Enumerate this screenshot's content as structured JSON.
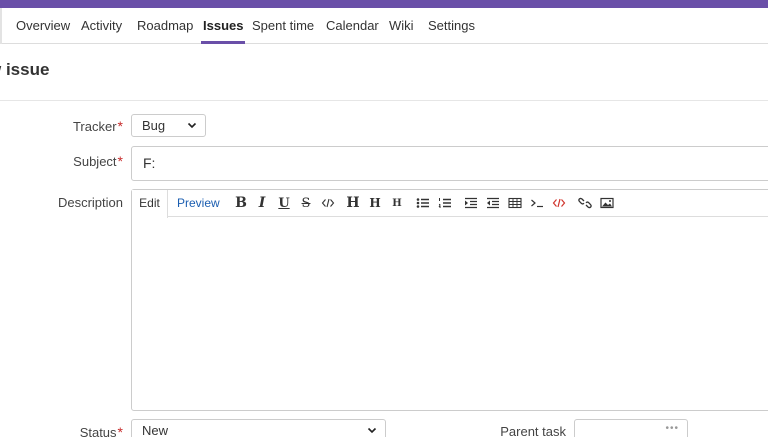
{
  "menu": {
    "items": [
      {
        "label": "Overview"
      },
      {
        "label": "Activity"
      },
      {
        "label": "Roadmap"
      },
      {
        "label": "Issues"
      },
      {
        "label": "Spent time"
      },
      {
        "label": "Calendar"
      },
      {
        "label": "Wiki"
      },
      {
        "label": "Settings"
      }
    ],
    "active": "Issues"
  },
  "page": {
    "title": "w issue"
  },
  "form": {
    "tracker": {
      "label": "Tracker",
      "required_mark": "*",
      "value": "Bug"
    },
    "subject": {
      "label": "Subject",
      "required_mark": "*",
      "value": "F:"
    },
    "description": {
      "label": "Description",
      "tab_edit": "Edit",
      "tab_preview": "Preview",
      "toolbar": {
        "bold": "B",
        "italic": "I",
        "underline": "U",
        "strike": "S",
        "h1": "H",
        "h2": "H",
        "h3": "H"
      }
    },
    "status": {
      "label": "Status",
      "required_mark": "*",
      "value": "New"
    },
    "parent_task": {
      "label": "Parent task",
      "value": "",
      "more": "•••"
    }
  },
  "colors": {
    "accent": "#6a4fa8",
    "link": "#1a5db0",
    "required": "#c62828",
    "code_red": "#d0342c"
  }
}
